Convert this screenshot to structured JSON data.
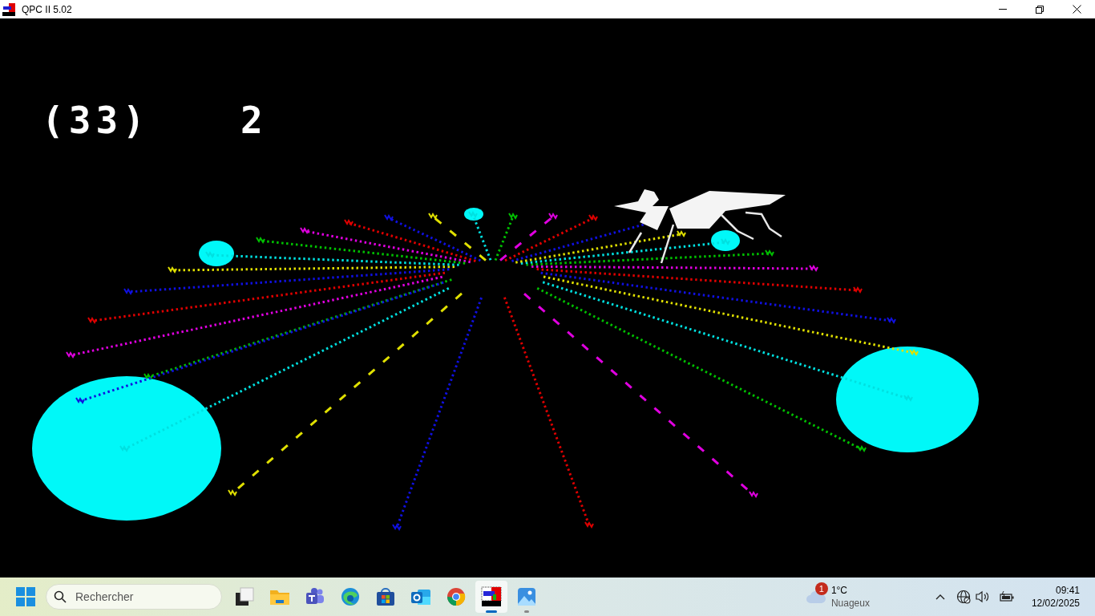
{
  "window": {
    "title": "QPC II 5.02"
  },
  "game": {
    "counter": "(33)",
    "value": "2"
  },
  "taskbar": {
    "search": {
      "placeholder": "Rechercher"
    },
    "apps": [
      {
        "kind": "taskview",
        "selected": false,
        "running": false
      },
      {
        "kind": "files",
        "selected": false,
        "running": false
      },
      {
        "kind": "teams",
        "selected": false,
        "running": false
      },
      {
        "kind": "edge",
        "selected": false,
        "running": false
      },
      {
        "kind": "store",
        "selected": false,
        "running": false
      },
      {
        "kind": "outlook",
        "selected": false,
        "running": false
      },
      {
        "kind": "chrome",
        "selected": false,
        "running": false
      },
      {
        "kind": "qpc",
        "selected": true,
        "running": true
      },
      {
        "kind": "photos",
        "selected": false,
        "running": true
      }
    ],
    "weather": {
      "badge": "1",
      "temperature": "1°C",
      "condition": "Nuageux"
    },
    "clock": {
      "time": "09:41",
      "date": "12/02/2025"
    }
  }
}
